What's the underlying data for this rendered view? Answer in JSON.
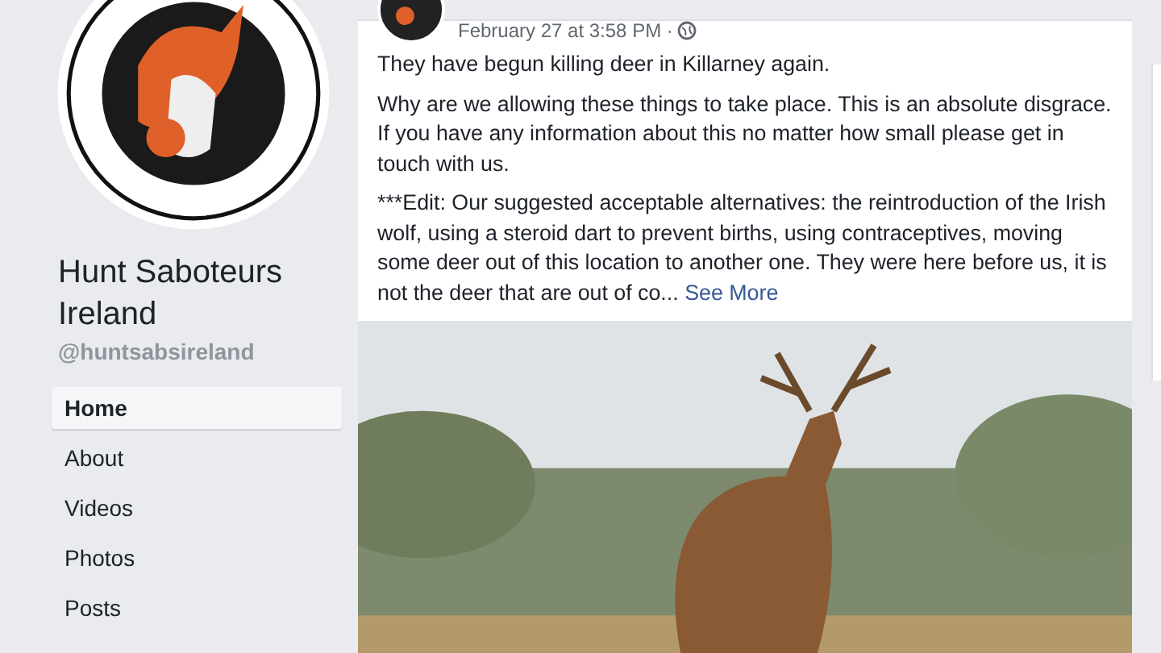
{
  "page": {
    "name": "Hunt Saboteurs Ireland",
    "handle": "@huntsabsireland"
  },
  "nav": [
    {
      "label": "Home",
      "selected": true
    },
    {
      "label": "About",
      "selected": false
    },
    {
      "label": "Videos",
      "selected": false
    },
    {
      "label": "Photos",
      "selected": false
    },
    {
      "label": "Posts",
      "selected": false
    }
  ],
  "post": {
    "timestamp": "February 27 at 3:58 PM ·",
    "paragraphs": [
      "They have begun killing deer in Killarney again.",
      "Why are we allowing these things to take place. This is an absolute disgrace. If you have any information about this no matter how small please get in touch with us.",
      "***Edit: Our suggested acceptable alternatives: the reintroduction of the Irish wolf, using a steroid dart to prevent births, using contraceptives, moving some deer out of this location to another one. They were here before us, it is not the deer that are out of co..."
    ],
    "see_more": "See More"
  }
}
